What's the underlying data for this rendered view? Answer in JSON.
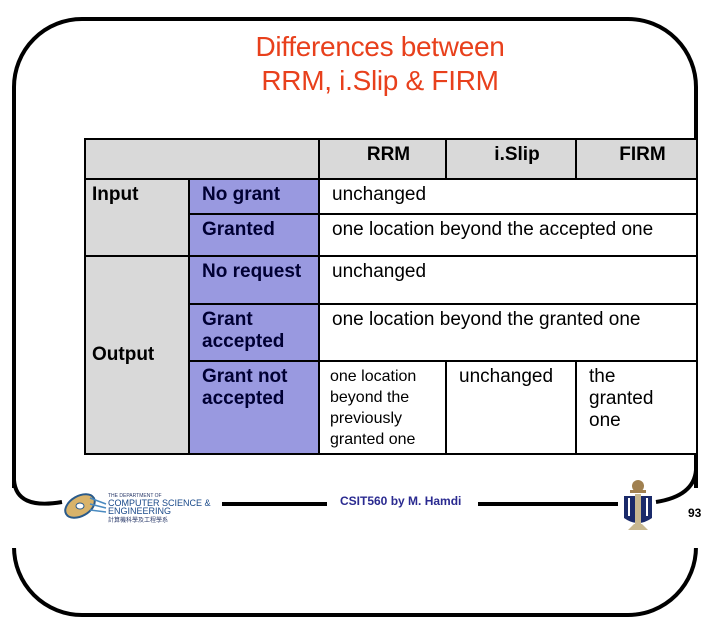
{
  "slide": {
    "title_line1": "Differences between",
    "title_line2": "RRM, i.Slip & FIRM",
    "footer": "CSIT560 by M. Hamdi",
    "page_number": "93",
    "dept_logo": {
      "line1": "THE DEPARTMENT OF",
      "line2": "COMPUTER SCIENCE &",
      "line3": "ENGINEERING",
      "line4": "計算機科學及工程學系"
    }
  },
  "table": {
    "headers": [
      "",
      "RRM",
      "i.Slip",
      "FIRM"
    ],
    "groups": [
      {
        "label": "Input",
        "rows": [
          {
            "condition": "No grant",
            "merged": "unchanged"
          },
          {
            "condition": "Granted",
            "merged": "one location beyond the accepted one"
          }
        ]
      },
      {
        "label": "Output",
        "rows": [
          {
            "condition": "No request",
            "merged": "unchanged"
          },
          {
            "condition": "Grant accepted",
            "merged": "one location beyond the granted one"
          },
          {
            "condition": "Grant not accepted",
            "rrm": "one location beyond the previously granted one",
            "islip": "unchanged",
            "firm": "the granted one"
          }
        ]
      }
    ]
  },
  "colors": {
    "title": "#e8401c",
    "header_bg": "#d9d9d9",
    "condition_bg": "#9999e0",
    "footer_text": "#2a2a90"
  }
}
